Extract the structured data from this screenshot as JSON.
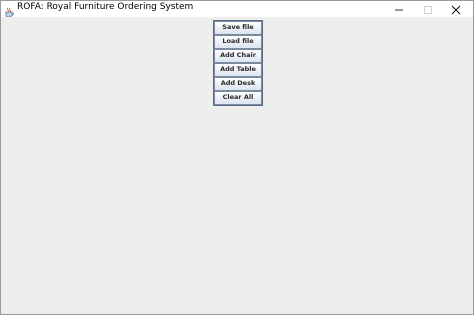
{
  "window": {
    "title": "ROFA: Royal Furniture Ordering System"
  },
  "titlebar_icons": {
    "app": "java-cup-icon",
    "minimize": "minimize-icon",
    "maximize": "maximize-icon",
    "close": "close-icon"
  },
  "toolbar": {
    "buttons": [
      {
        "label": "Save file"
      },
      {
        "label": "Load file"
      },
      {
        "label": "Add Chair"
      },
      {
        "label": "Add Table"
      },
      {
        "label": "Add Desk"
      },
      {
        "label": "Clear All"
      }
    ]
  },
  "colors": {
    "content_background": "#eeeeee",
    "button_border": "#5a6a80"
  }
}
